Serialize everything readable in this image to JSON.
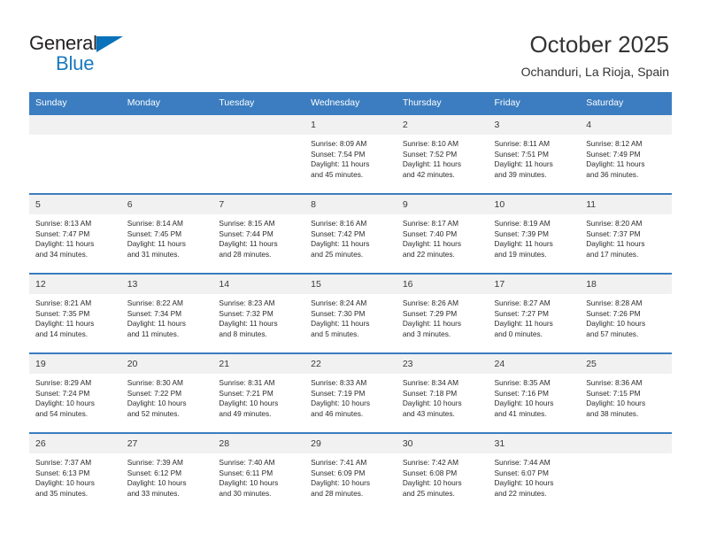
{
  "brand": {
    "name_part1": "General",
    "name_part2": "Blue",
    "accent_color": "#1879bf",
    "triangle_color": "#0a72bb"
  },
  "header": {
    "title": "October 2025",
    "location": "Ochanduri, La Rioja, Spain"
  },
  "calendar": {
    "header_bg": "#3b7dc0",
    "daynum_bg": "#f1f1f1",
    "weekday_headers": [
      "Sunday",
      "Monday",
      "Tuesday",
      "Wednesday",
      "Thursday",
      "Friday",
      "Saturday"
    ],
    "weeks": [
      [
        {
          "day": "",
          "sunrise": "",
          "sunset": "",
          "daylight_line1": "",
          "daylight_line2": ""
        },
        {
          "day": "",
          "sunrise": "",
          "sunset": "",
          "daylight_line1": "",
          "daylight_line2": ""
        },
        {
          "day": "",
          "sunrise": "",
          "sunset": "",
          "daylight_line1": "",
          "daylight_line2": ""
        },
        {
          "day": "1",
          "sunrise": "Sunrise: 8:09 AM",
          "sunset": "Sunset: 7:54 PM",
          "daylight_line1": "Daylight: 11 hours",
          "daylight_line2": "and 45 minutes."
        },
        {
          "day": "2",
          "sunrise": "Sunrise: 8:10 AM",
          "sunset": "Sunset: 7:52 PM",
          "daylight_line1": "Daylight: 11 hours",
          "daylight_line2": "and 42 minutes."
        },
        {
          "day": "3",
          "sunrise": "Sunrise: 8:11 AM",
          "sunset": "Sunset: 7:51 PM",
          "daylight_line1": "Daylight: 11 hours",
          "daylight_line2": "and 39 minutes."
        },
        {
          "day": "4",
          "sunrise": "Sunrise: 8:12 AM",
          "sunset": "Sunset: 7:49 PM",
          "daylight_line1": "Daylight: 11 hours",
          "daylight_line2": "and 36 minutes."
        }
      ],
      [
        {
          "day": "5",
          "sunrise": "Sunrise: 8:13 AM",
          "sunset": "Sunset: 7:47 PM",
          "daylight_line1": "Daylight: 11 hours",
          "daylight_line2": "and 34 minutes."
        },
        {
          "day": "6",
          "sunrise": "Sunrise: 8:14 AM",
          "sunset": "Sunset: 7:45 PM",
          "daylight_line1": "Daylight: 11 hours",
          "daylight_line2": "and 31 minutes."
        },
        {
          "day": "7",
          "sunrise": "Sunrise: 8:15 AM",
          "sunset": "Sunset: 7:44 PM",
          "daylight_line1": "Daylight: 11 hours",
          "daylight_line2": "and 28 minutes."
        },
        {
          "day": "8",
          "sunrise": "Sunrise: 8:16 AM",
          "sunset": "Sunset: 7:42 PM",
          "daylight_line1": "Daylight: 11 hours",
          "daylight_line2": "and 25 minutes."
        },
        {
          "day": "9",
          "sunrise": "Sunrise: 8:17 AM",
          "sunset": "Sunset: 7:40 PM",
          "daylight_line1": "Daylight: 11 hours",
          "daylight_line2": "and 22 minutes."
        },
        {
          "day": "10",
          "sunrise": "Sunrise: 8:19 AM",
          "sunset": "Sunset: 7:39 PM",
          "daylight_line1": "Daylight: 11 hours",
          "daylight_line2": "and 19 minutes."
        },
        {
          "day": "11",
          "sunrise": "Sunrise: 8:20 AM",
          "sunset": "Sunset: 7:37 PM",
          "daylight_line1": "Daylight: 11 hours",
          "daylight_line2": "and 17 minutes."
        }
      ],
      [
        {
          "day": "12",
          "sunrise": "Sunrise: 8:21 AM",
          "sunset": "Sunset: 7:35 PM",
          "daylight_line1": "Daylight: 11 hours",
          "daylight_line2": "and 14 minutes."
        },
        {
          "day": "13",
          "sunrise": "Sunrise: 8:22 AM",
          "sunset": "Sunset: 7:34 PM",
          "daylight_line1": "Daylight: 11 hours",
          "daylight_line2": "and 11 minutes."
        },
        {
          "day": "14",
          "sunrise": "Sunrise: 8:23 AM",
          "sunset": "Sunset: 7:32 PM",
          "daylight_line1": "Daylight: 11 hours",
          "daylight_line2": "and 8 minutes."
        },
        {
          "day": "15",
          "sunrise": "Sunrise: 8:24 AM",
          "sunset": "Sunset: 7:30 PM",
          "daylight_line1": "Daylight: 11 hours",
          "daylight_line2": "and 5 minutes."
        },
        {
          "day": "16",
          "sunrise": "Sunrise: 8:26 AM",
          "sunset": "Sunset: 7:29 PM",
          "daylight_line1": "Daylight: 11 hours",
          "daylight_line2": "and 3 minutes."
        },
        {
          "day": "17",
          "sunrise": "Sunrise: 8:27 AM",
          "sunset": "Sunset: 7:27 PM",
          "daylight_line1": "Daylight: 11 hours",
          "daylight_line2": "and 0 minutes."
        },
        {
          "day": "18",
          "sunrise": "Sunrise: 8:28 AM",
          "sunset": "Sunset: 7:26 PM",
          "daylight_line1": "Daylight: 10 hours",
          "daylight_line2": "and 57 minutes."
        }
      ],
      [
        {
          "day": "19",
          "sunrise": "Sunrise: 8:29 AM",
          "sunset": "Sunset: 7:24 PM",
          "daylight_line1": "Daylight: 10 hours",
          "daylight_line2": "and 54 minutes."
        },
        {
          "day": "20",
          "sunrise": "Sunrise: 8:30 AM",
          "sunset": "Sunset: 7:22 PM",
          "daylight_line1": "Daylight: 10 hours",
          "daylight_line2": "and 52 minutes."
        },
        {
          "day": "21",
          "sunrise": "Sunrise: 8:31 AM",
          "sunset": "Sunset: 7:21 PM",
          "daylight_line1": "Daylight: 10 hours",
          "daylight_line2": "and 49 minutes."
        },
        {
          "day": "22",
          "sunrise": "Sunrise: 8:33 AM",
          "sunset": "Sunset: 7:19 PM",
          "daylight_line1": "Daylight: 10 hours",
          "daylight_line2": "and 46 minutes."
        },
        {
          "day": "23",
          "sunrise": "Sunrise: 8:34 AM",
          "sunset": "Sunset: 7:18 PM",
          "daylight_line1": "Daylight: 10 hours",
          "daylight_line2": "and 43 minutes."
        },
        {
          "day": "24",
          "sunrise": "Sunrise: 8:35 AM",
          "sunset": "Sunset: 7:16 PM",
          "daylight_line1": "Daylight: 10 hours",
          "daylight_line2": "and 41 minutes."
        },
        {
          "day": "25",
          "sunrise": "Sunrise: 8:36 AM",
          "sunset": "Sunset: 7:15 PM",
          "daylight_line1": "Daylight: 10 hours",
          "daylight_line2": "and 38 minutes."
        }
      ],
      [
        {
          "day": "26",
          "sunrise": "Sunrise: 7:37 AM",
          "sunset": "Sunset: 6:13 PM",
          "daylight_line1": "Daylight: 10 hours",
          "daylight_line2": "and 35 minutes."
        },
        {
          "day": "27",
          "sunrise": "Sunrise: 7:39 AM",
          "sunset": "Sunset: 6:12 PM",
          "daylight_line1": "Daylight: 10 hours",
          "daylight_line2": "and 33 minutes."
        },
        {
          "day": "28",
          "sunrise": "Sunrise: 7:40 AM",
          "sunset": "Sunset: 6:11 PM",
          "daylight_line1": "Daylight: 10 hours",
          "daylight_line2": "and 30 minutes."
        },
        {
          "day": "29",
          "sunrise": "Sunrise: 7:41 AM",
          "sunset": "Sunset: 6:09 PM",
          "daylight_line1": "Daylight: 10 hours",
          "daylight_line2": "and 28 minutes."
        },
        {
          "day": "30",
          "sunrise": "Sunrise: 7:42 AM",
          "sunset": "Sunset: 6:08 PM",
          "daylight_line1": "Daylight: 10 hours",
          "daylight_line2": "and 25 minutes."
        },
        {
          "day": "31",
          "sunrise": "Sunrise: 7:44 AM",
          "sunset": "Sunset: 6:07 PM",
          "daylight_line1": "Daylight: 10 hours",
          "daylight_line2": "and 22 minutes."
        },
        {
          "day": "",
          "sunrise": "",
          "sunset": "",
          "daylight_line1": "",
          "daylight_line2": ""
        }
      ]
    ]
  }
}
